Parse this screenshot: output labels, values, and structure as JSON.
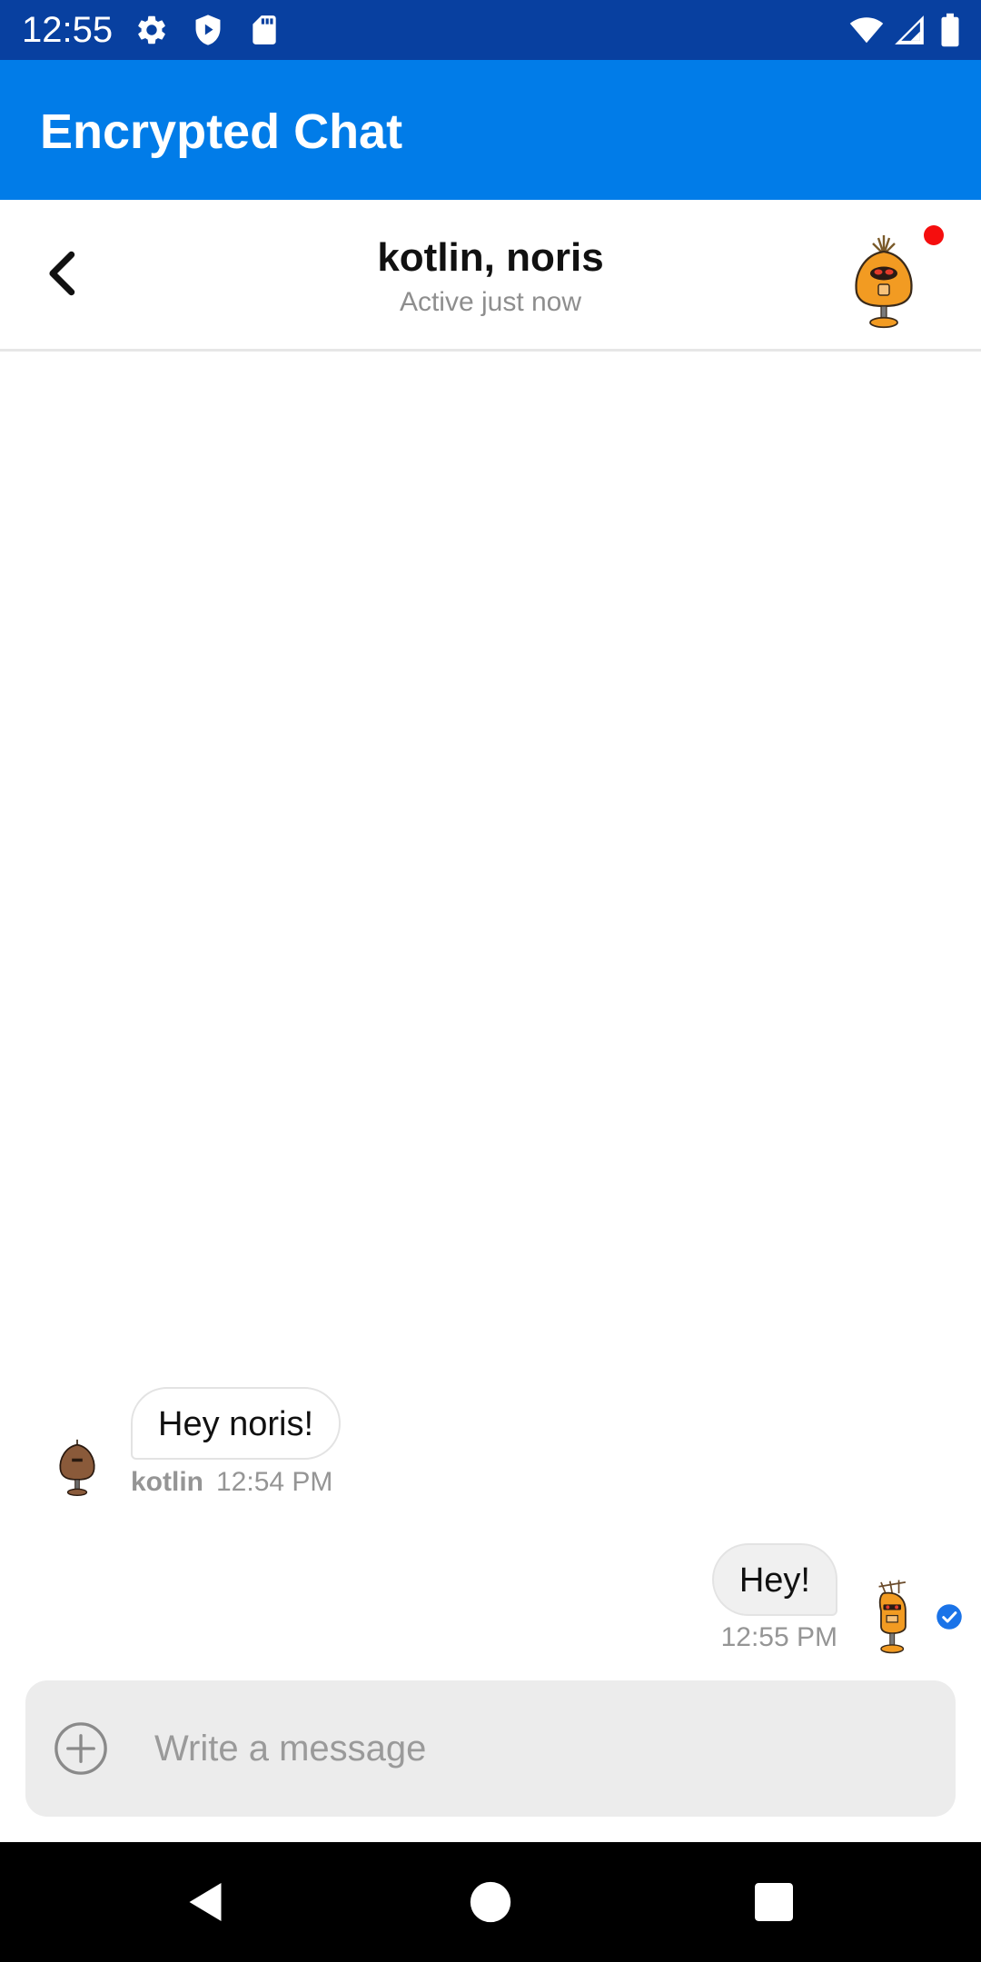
{
  "status_bar": {
    "time": "12:55",
    "left_icons": [
      "gear-icon",
      "shield-play-icon",
      "sd-card-icon"
    ],
    "right_icons": [
      "wifi-icon",
      "cellular-signal-icon",
      "battery-icon"
    ],
    "background_color": "#0840a0"
  },
  "app_bar": {
    "title": "Encrypted Chat",
    "background_color": "#017ce8"
  },
  "chat_header": {
    "back_icon": "chevron-left-icon",
    "title": "kotlin, noris",
    "subtitle": "Active just now",
    "avatar_icon": "orange-robot-avatar-icon",
    "presence_indicator_color": "#f50e0e"
  },
  "messages": [
    {
      "direction": "incoming",
      "text": "Hey noris!",
      "author": "kotlin",
      "time": "12:54 PM",
      "avatar_icon": "brown-robot-avatar-icon"
    },
    {
      "direction": "outgoing",
      "text": "Hey!",
      "time": "12:55 PM",
      "avatar_icon": "orange-antenna-robot-avatar-icon",
      "status_icon": "read-check-icon"
    }
  ],
  "composer": {
    "attach_icon": "plus-circle-icon",
    "placeholder": "Write a message",
    "value": ""
  },
  "nav_bar": {
    "buttons": [
      "back-triangle-icon",
      "home-circle-icon",
      "recents-square-icon"
    ]
  },
  "colors": {
    "accent": "#017ce8",
    "read_check": "#1a73e8",
    "meta_text": "#959595"
  }
}
